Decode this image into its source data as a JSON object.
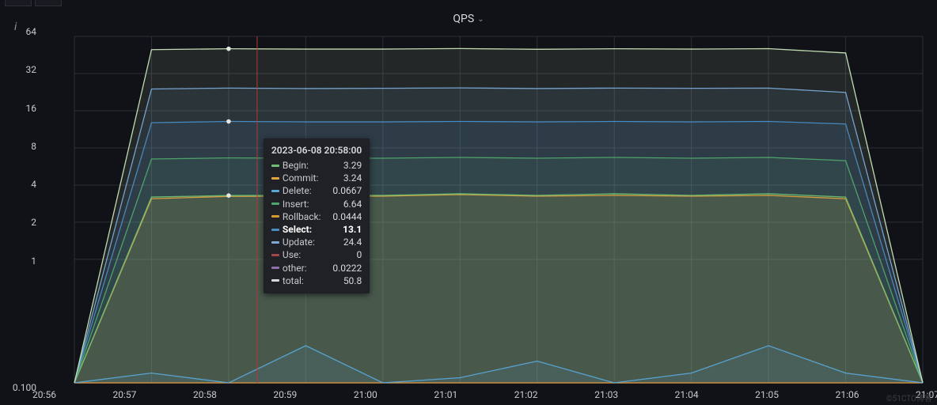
{
  "header": {
    "title": "QPS"
  },
  "axes": {
    "y_ticks": [
      64,
      32,
      16,
      8,
      4,
      2,
      1,
      "0.100"
    ],
    "x_ticks": [
      "20:56",
      "20:57",
      "20:58",
      "20:59",
      "21:00",
      "21:01",
      "21:02",
      "21:03",
      "21:04",
      "21:05",
      "21:06",
      "21:07"
    ]
  },
  "tooltip": {
    "title": "2023-06-08 20:58:00",
    "rows": [
      {
        "color": "#6fbf73",
        "name": "Begin:",
        "value": "3.29"
      },
      {
        "color": "#e0a33e",
        "name": "Commit:",
        "value": "3.24"
      },
      {
        "color": "#5aa6d6",
        "name": "Delete:",
        "value": "0.0667"
      },
      {
        "color": "#4fa86b",
        "name": "Insert:",
        "value": "6.64"
      },
      {
        "color": "#d59a2e",
        "name": "Rollback:",
        "value": "0.0444"
      },
      {
        "color": "#4a8cc4",
        "name": "Select:",
        "value": "13.1",
        "selected": true
      },
      {
        "color": "#7aa9d6",
        "name": "Update:",
        "value": "24.4"
      },
      {
        "color": "#a04747",
        "name": "Use:",
        "value": "0"
      },
      {
        "color": "#8f6fae",
        "name": "other:",
        "value": "0.0222"
      },
      {
        "color": "#d8d9da",
        "name": "total:",
        "value": "50.8"
      }
    ]
  },
  "chart_data": {
    "type": "area",
    "title": "QPS",
    "xlabel": "",
    "ylabel": "",
    "yscale": "log",
    "ylim": [
      0.1,
      64
    ],
    "x": [
      "20:56",
      "20:57",
      "20:58",
      "20:59",
      "21:00",
      "21:01",
      "21:02",
      "21:03",
      "21:04",
      "21:05",
      "21:06",
      "21:07"
    ],
    "x_index_hover": 2,
    "hover_timestamp": "2023-06-08 20:58:00",
    "series": [
      {
        "name": "Begin",
        "color": "#6fbf73",
        "values": [
          0.1,
          3.2,
          3.29,
          3.3,
          3.3,
          3.4,
          3.3,
          3.4,
          3.3,
          3.4,
          3.2,
          0.1
        ]
      },
      {
        "name": "Commit",
        "color": "#e0a33e",
        "values": [
          0.1,
          3.1,
          3.24,
          3.25,
          3.25,
          3.35,
          3.25,
          3.3,
          3.25,
          3.3,
          3.1,
          0.1
        ]
      },
      {
        "name": "Delete",
        "color": "#5aa6d6",
        "values": [
          0.1,
          0.12,
          0.0667,
          0.2,
          0.1,
          0.11,
          0.15,
          0.1,
          0.12,
          0.2,
          0.12,
          0.1
        ]
      },
      {
        "name": "Insert",
        "color": "#4fa86b",
        "values": [
          0.1,
          6.5,
          6.64,
          6.6,
          6.6,
          6.7,
          6.6,
          6.7,
          6.6,
          6.7,
          6.3,
          0.1
        ]
      },
      {
        "name": "Rollback",
        "color": "#d59a2e",
        "values": [
          0.1,
          0.1,
          0.0444,
          0.1,
          0.1,
          0.1,
          0.1,
          0.1,
          0.1,
          0.1,
          0.1,
          0.1
        ]
      },
      {
        "name": "Select",
        "color": "#4a8cc4",
        "values": [
          0.1,
          12.8,
          13.1,
          13.0,
          13.0,
          13.1,
          13.0,
          13.1,
          13.0,
          13.1,
          12.5,
          0.1
        ]
      },
      {
        "name": "Update",
        "color": "#7aa9d6",
        "values": [
          0.1,
          24.0,
          24.4,
          24.2,
          24.3,
          24.5,
          24.2,
          24.4,
          24.3,
          24.4,
          22.5,
          0.1
        ]
      },
      {
        "name": "Use",
        "color": "#a04747",
        "values": [
          0,
          0,
          0,
          0,
          0,
          0,
          0,
          0,
          0,
          0,
          0,
          0
        ]
      },
      {
        "name": "other",
        "color": "#8f6fae",
        "values": [
          0.1,
          0.1,
          0.0222,
          0.1,
          0.1,
          0.1,
          0.1,
          0.1,
          0.1,
          0.1,
          0.1,
          0.1
        ]
      },
      {
        "name": "total",
        "color": "#c9e6b8",
        "values": [
          0.1,
          50.0,
          50.8,
          50.5,
          50.5,
          51.0,
          50.3,
          50.8,
          50.5,
          50.9,
          47.0,
          0.1
        ]
      }
    ]
  },
  "watermark": "©51CTO博客"
}
